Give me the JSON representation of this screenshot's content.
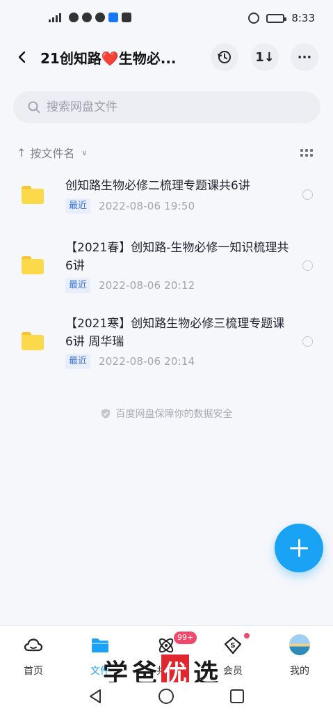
{
  "status_bar": {
    "time": "8:33",
    "network": "4G",
    "battery_level": 0.9
  },
  "header": {
    "title": "21创知路❤️生物必...",
    "icons": [
      "back-arrow-icon",
      "history-icon",
      "sort-icon",
      "more-icon"
    ],
    "sort_glyph": "1↓",
    "more_glyph": "···"
  },
  "search": {
    "placeholder": "搜索网盘文件"
  },
  "sort": {
    "label": "按文件名"
  },
  "files": [
    {
      "name": "创知路生物必修二梳理专题课共6讲",
      "badge": "最近",
      "date": "2022-08-06  19:50"
    },
    {
      "name": "【2021春】创知路-生物必修一知识梳理共6讲",
      "badge": "最近",
      "date": "2022-08-06  20:12"
    },
    {
      "name": "【2021寒】创知路生物必修三梳理专题课 6讲 周华瑞",
      "badge": "最近",
      "date": "2022-08-06  20:14"
    }
  ],
  "safety_note": "百度网盘保障你的数据安全",
  "bottom_nav": [
    {
      "label": "首页",
      "icon": "cloud-home-icon"
    },
    {
      "label": "文件",
      "icon": "folder-icon",
      "active": true
    },
    {
      "label": "共享",
      "icon": "share-atom-icon",
      "badge": "99+"
    },
    {
      "label": "会员",
      "icon": "vip-diamond-icon",
      "dot": true
    },
    {
      "label": "我的",
      "icon": "avatar"
    }
  ],
  "watermark": {
    "chars": [
      "学",
      "爸",
      "优",
      "选"
    ]
  },
  "colors": {
    "accent": "#1aa3f5",
    "folder": "#fcd94a",
    "badge_bg": "#e8eefb",
    "badge_text": "#3a74e0",
    "alert": "#f0476a"
  }
}
